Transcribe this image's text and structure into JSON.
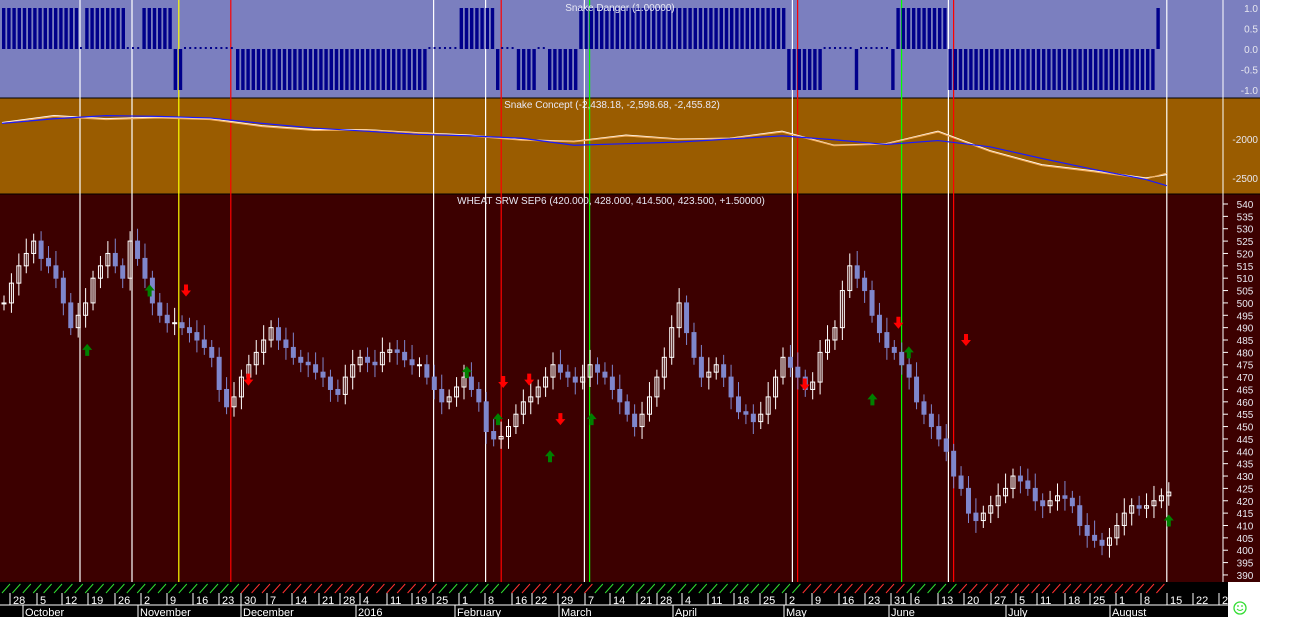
{
  "chart_data": [
    {
      "type": "bar",
      "title": "Snake Danger (1.00000)",
      "yticks": [
        "1.0",
        "0.5",
        "0.0",
        "-0.5",
        "-1.0"
      ],
      "ylim": [
        -1,
        1
      ],
      "runs": [
        [
          1,
          15
        ],
        [
          0,
          1
        ],
        [
          1,
          8
        ],
        [
          0,
          3
        ],
        [
          1,
          6
        ],
        [
          -1,
          2
        ],
        [
          0,
          10
        ],
        [
          -1,
          37
        ],
        [
          0,
          6
        ],
        [
          1,
          7
        ],
        [
          -1,
          1
        ],
        [
          0,
          3
        ],
        [
          -1,
          4
        ],
        [
          0,
          2
        ],
        [
          -1,
          6
        ],
        [
          1,
          40
        ],
        [
          -1,
          7
        ],
        [
          0,
          6
        ],
        [
          -1,
          1
        ],
        [
          0,
          6
        ],
        [
          -1,
          1
        ],
        [
          1,
          10
        ],
        [
          -1,
          40
        ],
        [
          1,
          1
        ]
      ],
      "colors": {
        "background": "#7b7fbf",
        "bar": "#00008b"
      }
    },
    {
      "type": "line",
      "title": "Snake Concept (-2,438.18, -2,598.68, -2,455.82)",
      "yticks": [
        "-2000",
        "-2500"
      ],
      "ylim": [
        -2700,
        -1500
      ],
      "x_bar_index": [
        0,
        10,
        20,
        30,
        40,
        50,
        60,
        70,
        80,
        90,
        100,
        110,
        120,
        130,
        140,
        150,
        160,
        170,
        180,
        190,
        200,
        210,
        220,
        224
      ],
      "series": [
        {
          "name": "white",
          "color": "#ffffff",
          "values": [
            -1790,
            -1700,
            -1740,
            -1720,
            -1740,
            -1830,
            -1880,
            -1880,
            -1920,
            -1950,
            -2010,
            -2030,
            -1950,
            -2000,
            -1990,
            -1900,
            -2080,
            -2060,
            -1900,
            -2150,
            -2330,
            -2410,
            -2500,
            -2456
          ]
        },
        {
          "name": "orange",
          "color": "#f4b060",
          "values": [
            -1800,
            -1710,
            -1750,
            -1730,
            -1750,
            -1840,
            -1890,
            -1885,
            -1925,
            -1960,
            -2015,
            -2035,
            -1960,
            -2005,
            -1995,
            -1910,
            -2085,
            -2065,
            -1910,
            -2160,
            -2340,
            -2420,
            -2510,
            -2438
          ]
        },
        {
          "name": "blue",
          "color": "#1a1aff",
          "values": [
            -1800,
            -1740,
            -1700,
            -1710,
            -1730,
            -1800,
            -1860,
            -1900,
            -1940,
            -1960,
            -1990,
            -2080,
            -2060,
            -2040,
            -2000,
            -1960,
            -2010,
            -2070,
            -2020,
            -2100,
            -2250,
            -2390,
            -2520,
            -2598
          ]
        }
      ],
      "colors": {
        "background": "#9a5c00"
      }
    },
    {
      "type": "candlestick",
      "title": "WHEAT SRW SEP6 (420.000, 428.000, 414.500, 423.500, +1.50000)",
      "ylim": [
        385,
        545
      ],
      "yticks": [
        "540",
        "535",
        "530",
        "525",
        "520",
        "515",
        "510",
        "505",
        "500",
        "495",
        "490",
        "485",
        "480",
        "475",
        "470",
        "465",
        "460",
        "455",
        "450",
        "445",
        "440",
        "435",
        "430",
        "425",
        "420",
        "415",
        "410",
        "405",
        "400",
        "395",
        "390"
      ],
      "bars": 224,
      "close": [
        500,
        508,
        515,
        520,
        525,
        518,
        515,
        510,
        500,
        490,
        495,
        500,
        510,
        515,
        520,
        515,
        510,
        525,
        518,
        510,
        500,
        495,
        492,
        492,
        490,
        488,
        485,
        482,
        478,
        465,
        458,
        462,
        470,
        475,
        480,
        485,
        490,
        485,
        482,
        478,
        476,
        475,
        472,
        470,
        465,
        463,
        470,
        475,
        478,
        476,
        475,
        480,
        481,
        480,
        477,
        475,
        475,
        470,
        465,
        460,
        462,
        466,
        470,
        465,
        460,
        448,
        445,
        446,
        450,
        455,
        460,
        462,
        466,
        470,
        475,
        472,
        470,
        468,
        470,
        475,
        472,
        470,
        465,
        460,
        455,
        450,
        455,
        462,
        470,
        478,
        490,
        500,
        488,
        478,
        470,
        472,
        475,
        470,
        462,
        456,
        455,
        452,
        455,
        462,
        470,
        478,
        474,
        470,
        465,
        468,
        480,
        485,
        490,
        505,
        515,
        510,
        505,
        495,
        488,
        482,
        480,
        475,
        470,
        460,
        455,
        450,
        445,
        440,
        430,
        425,
        415,
        412,
        415,
        418,
        422,
        425,
        430,
        428,
        425,
        420,
        418,
        420,
        422,
        421,
        418,
        410,
        406,
        404,
        402,
        405,
        410,
        415,
        418,
        417,
        418,
        420,
        422,
        423.5
      ],
      "signals": [
        {
          "type": "up",
          "bar": 16,
          "price": 481
        },
        {
          "type": "up",
          "bar": 28,
          "price": 505
        },
        {
          "type": "up",
          "bar": 89,
          "price": 472
        },
        {
          "type": "up",
          "bar": 95,
          "price": 453
        },
        {
          "type": "up",
          "bar": 105,
          "price": 438
        },
        {
          "type": "up",
          "bar": 113,
          "price": 453
        },
        {
          "type": "up",
          "bar": 167,
          "price": 461
        },
        {
          "type": "up",
          "bar": 174,
          "price": 480
        },
        {
          "type": "up",
          "bar": 224,
          "price": 412
        },
        {
          "type": "down",
          "bar": 35,
          "price": 505
        },
        {
          "type": "down",
          "bar": 47,
          "price": 469
        },
        {
          "type": "down",
          "bar": 96,
          "price": 468
        },
        {
          "type": "down",
          "bar": 101,
          "price": 469
        },
        {
          "type": "down",
          "bar": 107,
          "price": 453
        },
        {
          "type": "down",
          "bar": 154,
          "price": 467
        },
        {
          "type": "down",
          "bar": 172,
          "price": 492
        },
        {
          "type": "down",
          "bar": 185,
          "price": 485
        }
      ],
      "colors": {
        "background": "#3c0000",
        "up": "#ffffff",
        "down": "#7f86cc",
        "signal_up": "#008000",
        "signal_down": "#ff0000"
      }
    }
  ],
  "vlines": [
    {
      "bar": 15,
      "color": "#ffffff"
    },
    {
      "bar": 25,
      "color": "#ffffff"
    },
    {
      "bar": 34,
      "color": "#ffff00"
    },
    {
      "bar": 44,
      "color": "#ff0000"
    },
    {
      "bar": 83,
      "color": "#ffffff"
    },
    {
      "bar": 93,
      "color": "#ffffff"
    },
    {
      "bar": 96,
      "color": "#ff0000"
    },
    {
      "bar": 112,
      "color": "#ffffff"
    },
    {
      "bar": 113,
      "color": "#00ff00"
    },
    {
      "bar": 152,
      "color": "#ffffff"
    },
    {
      "bar": 153,
      "color": "#ff0000"
    },
    {
      "bar": 173,
      "color": "#00ff00"
    },
    {
      "bar": 182,
      "color": "#ffffff"
    },
    {
      "bar": 183,
      "color": "#ff0000"
    },
    {
      "bar": 224,
      "color": "#ffffff"
    }
  ],
  "date_axis": {
    "days": [
      "28",
      "5",
      "12",
      "19",
      "26",
      "2",
      "9",
      "16",
      "23",
      "30",
      "7",
      "14",
      "21",
      "28",
      "4",
      "11",
      "19",
      "25",
      "1",
      "8",
      "16",
      "22",
      "29",
      "7",
      "14",
      "21",
      "28",
      "4",
      "11",
      "18",
      "25",
      "2",
      "9",
      "16",
      "23",
      "31",
      "6",
      "13",
      "20",
      "27",
      "5",
      "11",
      "18",
      "25",
      "1",
      "8",
      "15",
      "22",
      "2"
    ],
    "months": [
      "October",
      "November",
      "December",
      "2016",
      "February",
      "March",
      "April",
      "May",
      "June",
      "July",
      "August"
    ]
  },
  "status_icon": "smiley-icon"
}
